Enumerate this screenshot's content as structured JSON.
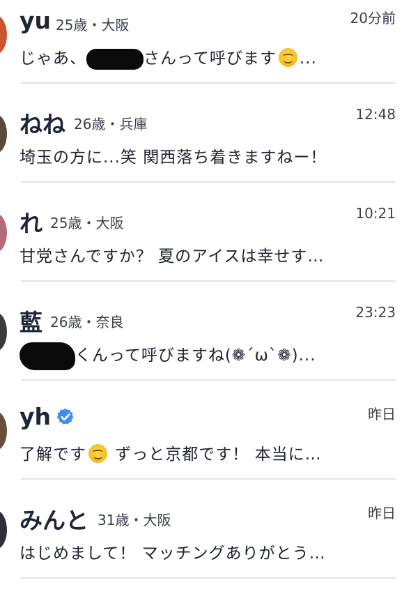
{
  "colors": {
    "name_text": "#1f2537",
    "meta_text": "#3a3f4b",
    "separator": "#e2e3e6",
    "verified_badge": "#3d8ef0",
    "emoji_face": "#f6b91e"
  },
  "conversations": [
    {
      "name": "yu",
      "meta": "25歳・大阪",
      "time": "20分前",
      "message_before": "じゃあ、",
      "message_redacted": true,
      "message_after": "さんって呼びます",
      "message_emoji": "smiling-face-emoji",
      "message_tail": "..."
    },
    {
      "name": "ねね",
      "meta": "26歳・兵庫",
      "time": "12:48",
      "message": "埼玉の方に...笑 関西落ち着きますねー！"
    },
    {
      "name": "れ",
      "meta": "25歳・大阪",
      "time": "10:21",
      "message": "甘党さんですか？ 夏のアイスは幸せす…"
    },
    {
      "name": "藍",
      "meta": "26歳・奈良",
      "time": "23:23",
      "message_redacted": true,
      "message_after": "くんって呼びますね(❁´ω`❁)..."
    },
    {
      "name": "yh",
      "verified": true,
      "time": "昨日",
      "message_before": "了解です",
      "message_emoji": "smiling-face-emoji",
      "message_after": " ずっと京都です！ 本当に…"
    },
    {
      "name": "みんと",
      "meta": "31歳・大阪",
      "time": "昨日",
      "message": "はじめまして！ マッチングありがとう…"
    }
  ]
}
